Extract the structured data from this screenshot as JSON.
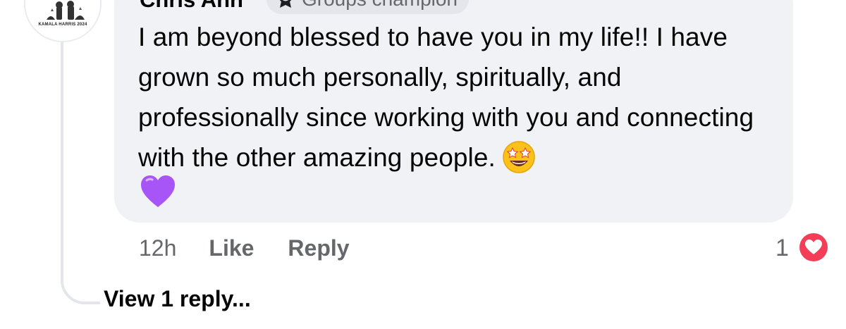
{
  "comment": {
    "author": "Chris Ann",
    "badge_label": "Groups champion",
    "badge_icon": "champion-trophy-icon",
    "avatar_caption": "KAMALA HARRIS 2024",
    "text": "I am beyond blessed to have you in my life!! I have grown so much personally, spiritually, and professionally since working with you and connecting with the other amazing people.",
    "emojis": [
      "star-struck-emoji",
      "purple-heart-emoji"
    ]
  },
  "actions": {
    "timestamp": "12h",
    "like_label": "Like",
    "reply_label": "Reply"
  },
  "reactions": {
    "count": "1",
    "type": "love-reaction-icon",
    "color": "#f33e58"
  },
  "replies": {
    "view_label": "View 1 reply..."
  },
  "colors": {
    "bubble": "#f0f2f5",
    "secondary_text": "#65676b",
    "primary_text": "#050505",
    "heart_purple": "#a855f7"
  }
}
